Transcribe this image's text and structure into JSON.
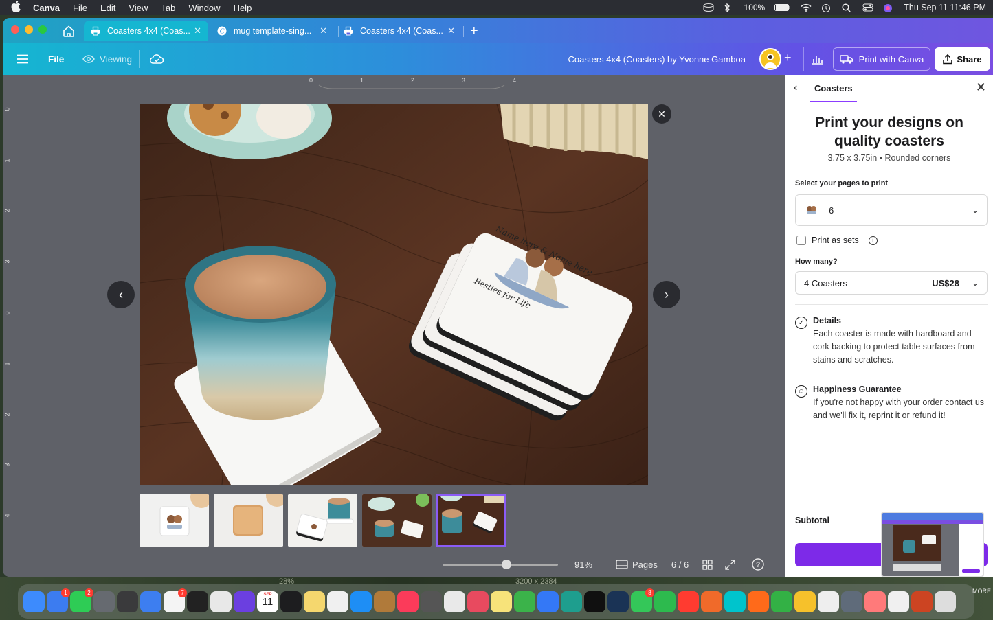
{
  "menubar": {
    "app": "Canva",
    "items": [
      "File",
      "Edit",
      "View",
      "Tab",
      "Window",
      "Help"
    ],
    "battery": "100%",
    "datetime": "Thu Sep 11  11:46 PM"
  },
  "tabs": [
    {
      "label": "Coasters 4x4 (Coas...",
      "active": true
    },
    {
      "label": "mug template-sing...",
      "active": false
    },
    {
      "label": "Coasters 4x4 (Coas...",
      "active": false
    }
  ],
  "toolbar": {
    "file": "File",
    "viewing": "Viewing",
    "doc_title": "Coasters 4x4 (Coasters) by Yvonne Gamboa",
    "print_label": "Print with Canva",
    "share_label": "Share"
  },
  "ruler": {
    "top": [
      "0",
      "1",
      "2",
      "3",
      "4"
    ],
    "left": [
      "0",
      "1",
      "2",
      "3",
      "0",
      "1",
      "2",
      "3",
      "4"
    ]
  },
  "coaster_text": {
    "top": "Name here & Name here",
    "bottom": "Besties for Life"
  },
  "bottom_bar": {
    "zoom": "91%",
    "pages_label": "Pages",
    "page_count": "6 / 6"
  },
  "panel": {
    "tab": "Coasters",
    "heading": "Print your designs on quality coasters",
    "subheading": "3.75 x 3.75in • Rounded corners",
    "select_label": "Select your pages to print",
    "pages_value": "6",
    "print_sets": "Print as sets",
    "how_many_label": "How many?",
    "quantity": "4 Coasters",
    "price": "US$28",
    "details_title": "Details",
    "details_text": "Each coaster is made with hardboard and cork backing to protect table surfaces from stains and scratches.",
    "guarantee_title": "Happiness Guarantee",
    "guarantee_text": "If you're not happy with your order contact us and we'll fix it, reprint it or refund it!",
    "subtotal": "Subtotal",
    "continue": "Co"
  },
  "behind_window": {
    "zoom": "28%",
    "size": "3200 x 2384"
  },
  "dock": {
    "more": "MORE",
    "calendar_month": "SEP",
    "calendar_day": "11",
    "icons": [
      "finder",
      "mail",
      "facetime",
      "system-settings",
      "calculator",
      "preview",
      "reminders",
      "clock",
      "launchpad",
      "imovie",
      "calendar",
      "quicktime",
      "notes",
      "keynote",
      "app-store",
      "money",
      "music",
      "photo-booth",
      "font-book",
      "pdf",
      "stickies",
      "cricut",
      "safari",
      "barcode",
      "screen",
      "terminal",
      "messages",
      "findmy",
      "news",
      "canva-sketch",
      "canva",
      "firefox",
      "numbers",
      "amphetamine",
      "chrome",
      "screenshot",
      "photos",
      "paint",
      "mosaic",
      "trash"
    ],
    "colors": [
      "#3d8bfd",
      "#3c7cf0",
      "#2ecc55",
      "#666a70",
      "#3a3a3c",
      "#3d7ef0",
      "#f4f4f4",
      "#222",
      "#e8e8e8",
      "#6b3fe0",
      "#ffffff",
      "#1d1d1f",
      "#f5d76e",
      "#f0f0f0",
      "#1e8ef5",
      "#b07a3a",
      "#fb3b5a",
      "#555",
      "#e9e9e9",
      "#e84a5f",
      "#f7e37a",
      "#3bb34a",
      "#3478f6",
      "#1e9e8e",
      "#101010",
      "#1a3355",
      "#34c759",
      "#2dba4e",
      "#ff3b30",
      "#f06a2a",
      "#00c4cc",
      "#ff6a1a",
      "#33b145",
      "#f6c12b",
      "#eeeeee",
      "#5f6b7a",
      "#ff7a7a",
      "#f0f0f0",
      "#cc4422",
      "#dddddd"
    ],
    "badges": {
      "1": "1",
      "2": "2",
      "6": "7",
      "26": "8"
    }
  }
}
